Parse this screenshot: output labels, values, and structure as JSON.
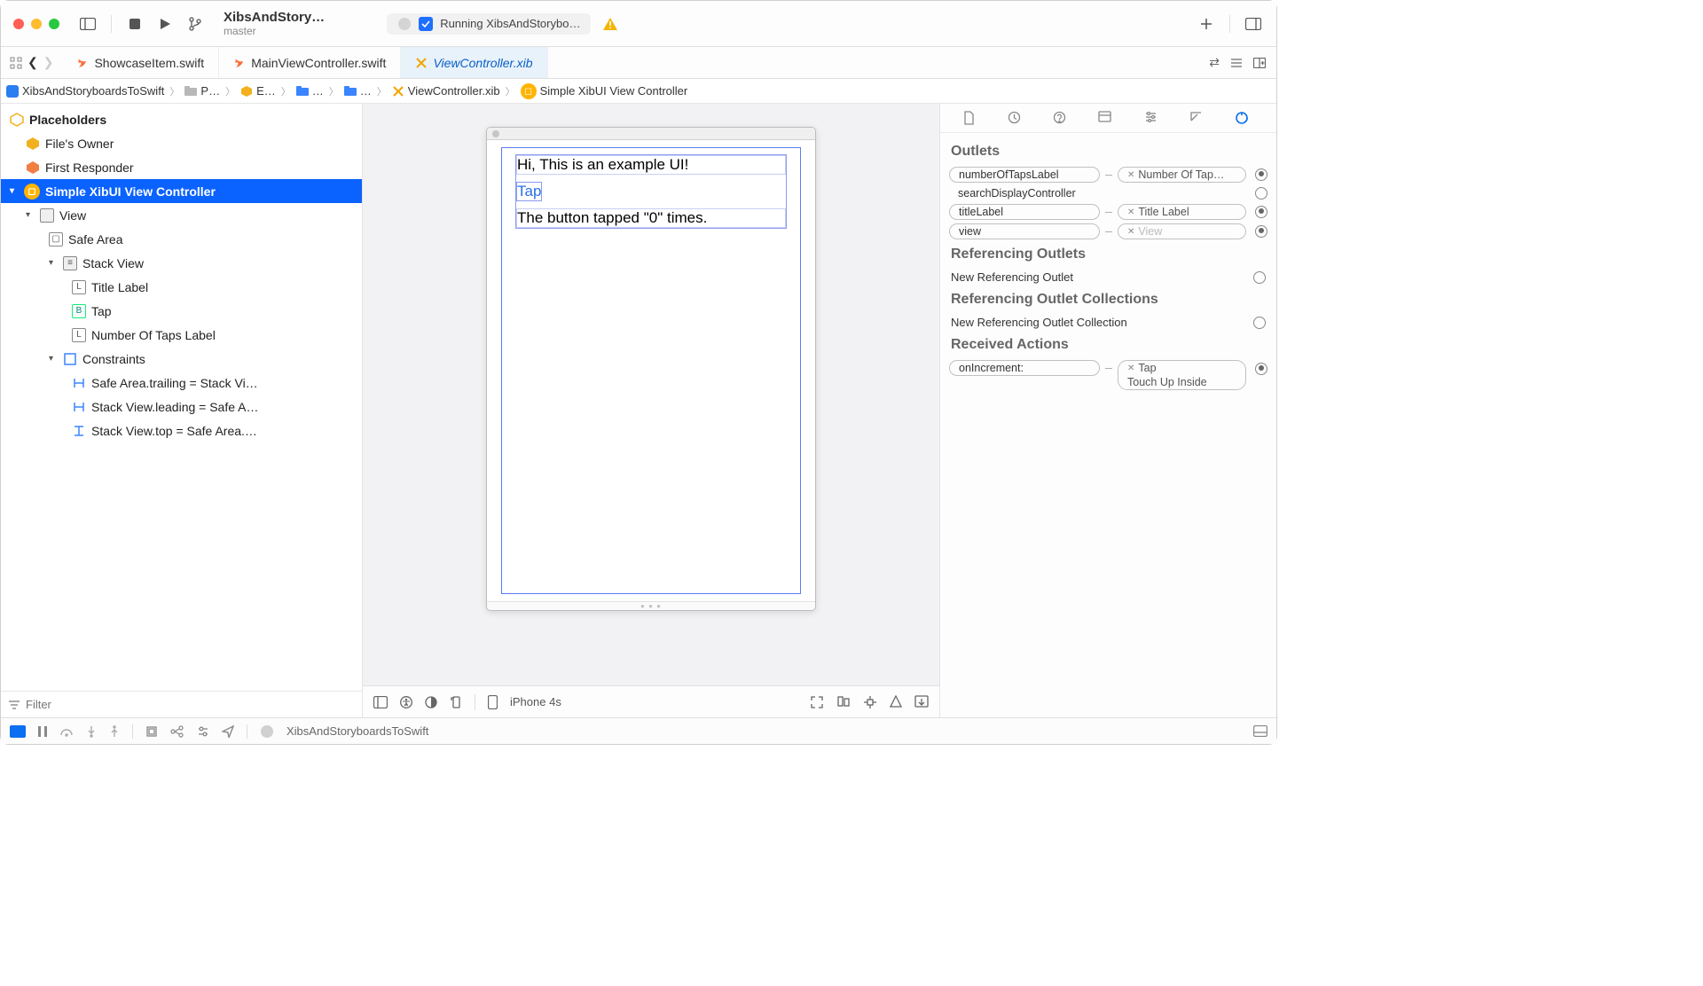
{
  "titlebar": {
    "project": "XibsAndStory…",
    "branch": "master",
    "activity": "Running XibsAndStorybo…"
  },
  "tabs": {
    "t1": "ShowcaseItem.swift",
    "t2": "MainViewController.swift",
    "t3": "ViewController.xib"
  },
  "breadcrumb": {
    "b0": "XibsAndStoryboardsToSwift",
    "b1": "P…",
    "b2": "E…",
    "b3": "…",
    "b4": "…",
    "b5": "ViewController.xib",
    "b6": "Simple XibUI View Controller"
  },
  "tree": {
    "placeholders": "Placeholders",
    "filesOwner": "File's Owner",
    "firstResponder": "First Responder",
    "controller": "Simple XibUI View Controller",
    "view": "View",
    "safeArea": "Safe Area",
    "stackView": "Stack View",
    "titleLabel": "Title Label",
    "tap": "Tap",
    "numTaps": "Number Of Taps Label",
    "constraints": "Constraints",
    "c1": "Safe Area.trailing = Stack Vi…",
    "c2": "Stack View.leading = Safe A…",
    "c3": "Stack View.top = Safe Area.…"
  },
  "filter": {
    "placeholder": "Filter"
  },
  "canvas": {
    "titleText": "Hi, This is an example UI!",
    "buttonText": "Tap",
    "countText": "The button tapped \"0\" times.",
    "device": "iPhone 4s"
  },
  "inspector": {
    "h_outlets": "Outlets",
    "o1": "numberOfTapsLabel",
    "o1r": "Number Of Tap…",
    "o2": "searchDisplayController",
    "o3": "titleLabel",
    "o3r": "Title Label",
    "o4": "view",
    "o4r": "View",
    "h_refout": "Referencing Outlets",
    "newRefOut": "New Referencing Outlet",
    "h_refcoll": "Referencing Outlet Collections",
    "newRefColl": "New Referencing Outlet Collection",
    "h_actions": "Received Actions",
    "a1": "onIncrement:",
    "a1r1": "Tap",
    "a1r2": "Touch Up Inside"
  },
  "debugbar": {
    "proc": "XibsAndStoryboardsToSwift"
  }
}
